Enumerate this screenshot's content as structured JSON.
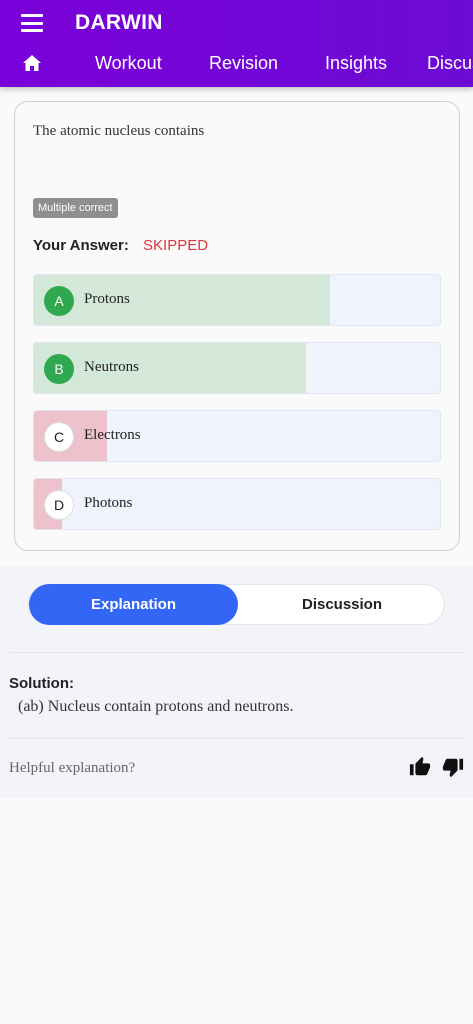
{
  "app": {
    "title": "DARWIN"
  },
  "nav": {
    "tabs": [
      "Workout",
      "Revision",
      "Insights",
      "Discussion"
    ]
  },
  "question": {
    "text": "The atomic nucleus contains",
    "badge": "Multiple correct",
    "answer_label": "Your Answer:",
    "answer_value": "SKIPPED",
    "options": [
      {
        "letter": "A",
        "text": "Protons",
        "state": "correct",
        "fill": 0.73,
        "color": "#d4e8d9"
      },
      {
        "letter": "B",
        "text": "Neutrons",
        "state": "correct",
        "fill": 0.67,
        "color": "#d4e8d9"
      },
      {
        "letter": "C",
        "text": "Electrons",
        "state": "neutral",
        "fill": 0.18,
        "color": "#eec2cc"
      },
      {
        "letter": "D",
        "text": "Photons",
        "state": "neutral",
        "fill": 0.07,
        "color": "#eec2cc"
      }
    ]
  },
  "tabs": {
    "explanation": "Explanation",
    "discussion": "Discussion",
    "accent": "#3466f6"
  },
  "solution": {
    "title": "Solution:",
    "text": "(ab) Nucleus contain protons and neutrons.",
    "helpful": "Helpful explanation?"
  },
  "icons": {
    "menu": "hamburger-icon",
    "home": "home-icon",
    "like": "thumbs-up-icon",
    "dislike": "thumbs-down-icon"
  }
}
